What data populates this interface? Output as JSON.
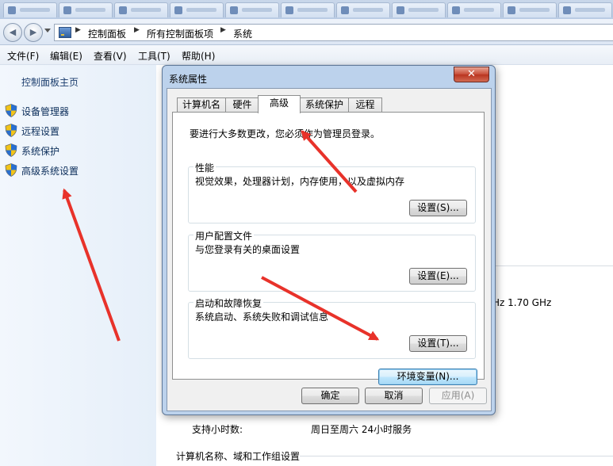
{
  "breadcrumb": [
    "控制面板",
    "所有控制面板项",
    "系统"
  ],
  "menu": [
    "文件(F)",
    "编辑(E)",
    "查看(V)",
    "工具(T)",
    "帮助(H)"
  ],
  "sidebar": {
    "home": "控制面板主页",
    "items": [
      {
        "label": "设备管理器",
        "icon": "shield-icon"
      },
      {
        "label": "远程设置",
        "icon": "shield-icon"
      },
      {
        "label": "系统保护",
        "icon": "shield-icon"
      },
      {
        "label": "高级系统设置",
        "icon": "shield-icon"
      }
    ]
  },
  "background": {
    "cpu_speed": "Hz   1.70 GHz",
    "support_hours_label": "支持小时数:",
    "support_hours_value": "周日至周六  24小时服务",
    "section_title": "计算机名称、域和工作组设置"
  },
  "dialog": {
    "title": "系统属性",
    "close_glyph": "✕",
    "tabs": [
      "计算机名",
      "硬件",
      "高级",
      "系统保护",
      "远程"
    ],
    "active_tab": "高级",
    "admin_note": "要进行大多数更改，您必须作为管理员登录。",
    "groups": [
      {
        "legend": "性能",
        "desc": "视觉效果，处理器计划，内存使用，以及虚拟内存",
        "button": "设置(S)..."
      },
      {
        "legend": "用户配置文件",
        "desc": "与您登录有关的桌面设置",
        "button": "设置(E)..."
      },
      {
        "legend": "启动和故障恢复",
        "desc": "系统启动、系统失败和调试信息",
        "button": "设置(T)..."
      }
    ],
    "env_button": "环境变量(N)...",
    "ok": "确定",
    "cancel": "取消",
    "apply": "应用(A)"
  },
  "colors": {
    "annotation_arrow": "#e8322a",
    "link": "#0b2d5a"
  }
}
